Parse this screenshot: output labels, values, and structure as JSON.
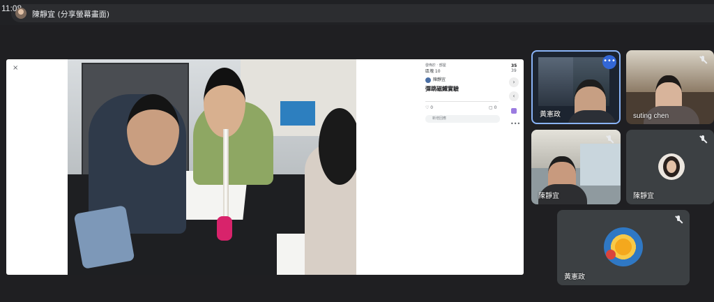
{
  "status_bar": {
    "time": "11:08"
  },
  "presenter": {
    "label": "陳靜宜 (分享螢幕畫面)"
  },
  "share": {
    "close_icon": "×",
    "panel": {
      "meta": "發佈於 ‧ 部屋",
      "number": "區塊 10",
      "user": "陳靜宜",
      "title": "彈跳磁鐵實驗",
      "likes": "0",
      "comments": "0",
      "input_placeholder": "新增回應"
    },
    "side": {
      "num1": "35",
      "num2": "39",
      "next": "›",
      "prev": "‹",
      "more": "•••"
    }
  },
  "participants": [
    {
      "name": "黃憲政",
      "tile": "t1",
      "active": true
    },
    {
      "name": "suting chen",
      "tile": "t2"
    },
    {
      "name": "陳靜宜",
      "tile": "t3"
    },
    {
      "name": "陳靜宜",
      "tile": "t4"
    },
    {
      "name": "黃憲政",
      "tile": "t5"
    }
  ],
  "more_options": "•••",
  "colors": {
    "background": "#1f1f22",
    "tile": "#3c4043",
    "active_border": "#8ab4f8",
    "more_button": "#3367d6"
  }
}
